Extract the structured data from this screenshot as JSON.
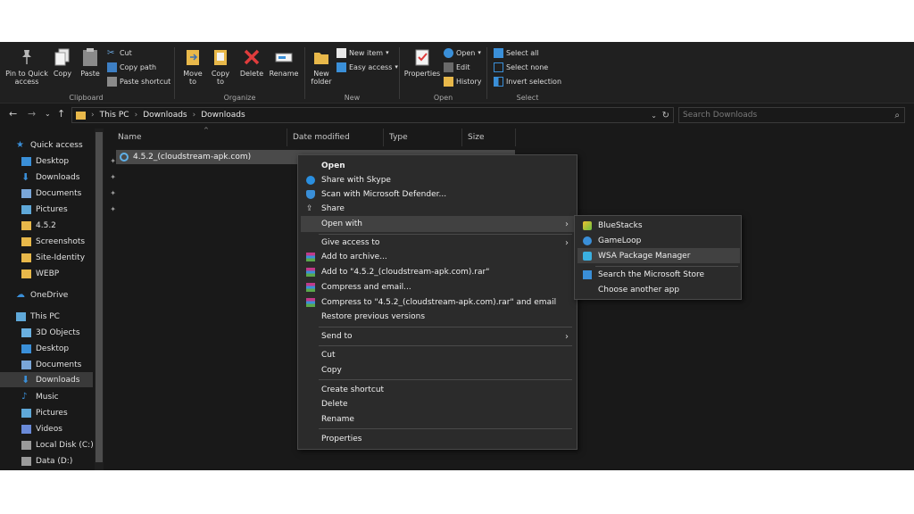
{
  "ribbon": {
    "clipboard": {
      "label": "Clipboard",
      "pin_label": "Pin to Quick access",
      "copy_label": "Copy",
      "paste_label": "Paste",
      "cut_label": "Cut",
      "copy_path_label": "Copy path",
      "paste_shortcut_label": "Paste shortcut"
    },
    "organize": {
      "label": "Organize",
      "move_to_label": "Move to",
      "copy_to_label": "Copy to",
      "delete_label": "Delete",
      "rename_label": "Rename"
    },
    "new": {
      "label": "New",
      "new_folder_label": "New folder",
      "new_item_label": "New item",
      "easy_access_label": "Easy access"
    },
    "open": {
      "label": "Open",
      "properties_label": "Properties",
      "open_label": "Open",
      "edit_label": "Edit",
      "history_label": "History"
    },
    "select": {
      "label": "Select",
      "select_all_label": "Select all",
      "select_none_label": "Select none",
      "invert_selection_label": "Invert selection"
    }
  },
  "address": {
    "path": [
      "This PC",
      "Downloads",
      "Downloads"
    ],
    "search_placeholder": "Search Downloads"
  },
  "nav": {
    "items": [
      {
        "label": "Quick access",
        "icon": "star-icon"
      },
      {
        "label": "Desktop",
        "icon": "desktop-icon",
        "pinned": true
      },
      {
        "label": "Downloads",
        "icon": "download-icon",
        "pinned": true
      },
      {
        "label": "Documents",
        "icon": "documents-icon",
        "pinned": true
      },
      {
        "label": "Pictures",
        "icon": "pictures-icon",
        "pinned": true
      },
      {
        "label": "4.5.2",
        "icon": "folder-icon"
      },
      {
        "label": "Screenshots",
        "icon": "folder-icon"
      },
      {
        "label": "Site-Identity",
        "icon": "folder-icon"
      },
      {
        "label": "WEBP",
        "icon": "folder-icon"
      },
      {
        "label": "OneDrive",
        "icon": "cloud-icon"
      },
      {
        "label": "This PC",
        "icon": "computer-icon"
      },
      {
        "label": "3D Objects",
        "icon": "cube-icon"
      },
      {
        "label": "Desktop",
        "icon": "desktop-icon"
      },
      {
        "label": "Documents",
        "icon": "documents-icon"
      },
      {
        "label": "Downloads",
        "icon": "download-icon",
        "selected": true
      },
      {
        "label": "Music",
        "icon": "music-icon"
      },
      {
        "label": "Pictures",
        "icon": "pictures-icon"
      },
      {
        "label": "Videos",
        "icon": "video-icon"
      },
      {
        "label": "Local Disk (C:)",
        "icon": "drive-icon"
      },
      {
        "label": "Data (D:)",
        "icon": "drive-icon"
      }
    ]
  },
  "filelist": {
    "columns": [
      "Name",
      "Date modified",
      "Type",
      "Size"
    ],
    "files": [
      {
        "name": "4.5.2_(cloudstream-apk.com)",
        "icon": "apk-file-icon"
      }
    ]
  },
  "context_menu": {
    "open": "Open",
    "share_skype": "Share with Skype",
    "scan_defender": "Scan with Microsoft Defender...",
    "share": "Share",
    "open_with": "Open with",
    "give_access": "Give access to",
    "add_archive": "Add to archive...",
    "add_rar": "Add to \"4.5.2_(cloudstream-apk.com).rar\"",
    "compress_email": "Compress and email...",
    "compress_rar_email": "Compress to \"4.5.2_(cloudstream-apk.com).rar\" and email",
    "restore_versions": "Restore previous versions",
    "send_to": "Send to",
    "cut": "Cut",
    "copy": "Copy",
    "create_shortcut": "Create shortcut",
    "delete": "Delete",
    "rename": "Rename",
    "properties": "Properties"
  },
  "open_with_menu": {
    "bluestacks": "BlueStacks",
    "gameloop": "GameLoop",
    "wsa": "WSA Package Manager",
    "search_store": "Search the Microsoft Store",
    "choose_app": "Choose another app"
  },
  "colors": {
    "window_bg": "#191919",
    "ribbon_bg": "#202020",
    "menu_bg": "#2b2b2b",
    "folder_yellow": "#e8b84a",
    "accent_blue": "#3a8fd8"
  }
}
